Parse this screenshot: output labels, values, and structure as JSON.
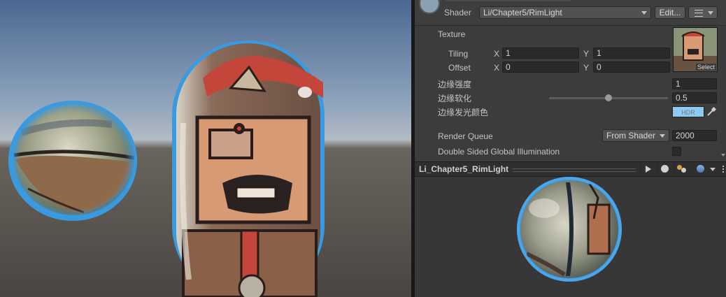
{
  "material_header": {
    "shader_label": "Shader",
    "shader_value": "Li/Chapter5/RimLight",
    "edit_label": "Edit...",
    "list_icon": "list-icon"
  },
  "texture": {
    "label": "Texture",
    "tiling_label": "Tiling",
    "offset_label": "Offset",
    "x_label": "X",
    "y_label": "Y",
    "tiling_x": "1",
    "tiling_y": "1",
    "offset_x": "0",
    "offset_y": "0",
    "select_label": "Select"
  },
  "properties": {
    "rim_strength_label": "边缘强度",
    "rim_strength_value": "1",
    "rim_soft_label": "边缘软化",
    "rim_soft_value": "0.5",
    "rim_soft_slider_fraction": 0.5,
    "rim_color_label": "边缘发光颜色",
    "rim_color_badge": "HDR",
    "rim_color": "#8fcaf0"
  },
  "render_queue": {
    "label": "Render Queue",
    "mode": "From Shader",
    "value": "2000"
  },
  "gi": {
    "label": "Double Sided Global Illumination",
    "checked": false
  },
  "preview": {
    "title": "Li_Chapter5_RimLight",
    "play_icon": "play-icon",
    "sphere_icon": "sphere-icon",
    "lighting_icon": "lighting-icon",
    "background_icon": "background-sphere-icon"
  },
  "colors": {
    "rim_glow": "#3a9ae0",
    "inspector_bg": "#3c3c3c",
    "sky_top": "#5a7aa6",
    "ground": "#4a4642"
  }
}
